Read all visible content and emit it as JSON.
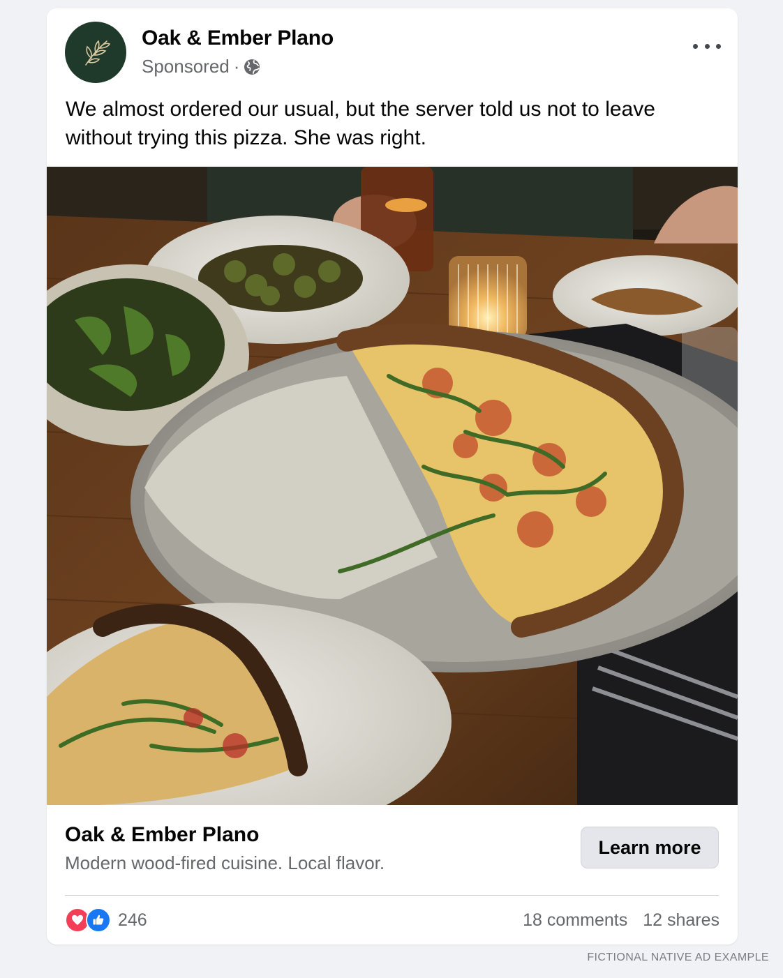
{
  "post": {
    "page_name": "Oak & Ember Plano",
    "sponsored_label": "Sponsored",
    "separator": "·",
    "audience_icon": "globe-icon",
    "avatar_icon": "olive-branch-icon",
    "more_icon": "more-horizontal-icon",
    "text": "We almost ordered our usual, but the server told us not to leave without trying this pizza. She was right."
  },
  "ad": {
    "title": "Oak & Ember Plano",
    "description": "Modern wood-fired cuisine. Local flavor.",
    "cta_label": "Learn more"
  },
  "engagement": {
    "reaction_icons": [
      "heart-icon",
      "like-icon"
    ],
    "reaction_count": "246",
    "comments": "18 comments",
    "shares": "12 shares"
  },
  "watermark": "FICTIONAL NATIVE AD EXAMPLE",
  "colors": {
    "avatar_bg": "#1f3a2a",
    "heart": "#f33e58",
    "like": "#1877f2",
    "secondary_text": "#65676b",
    "button_bg": "#e4e6eb"
  }
}
